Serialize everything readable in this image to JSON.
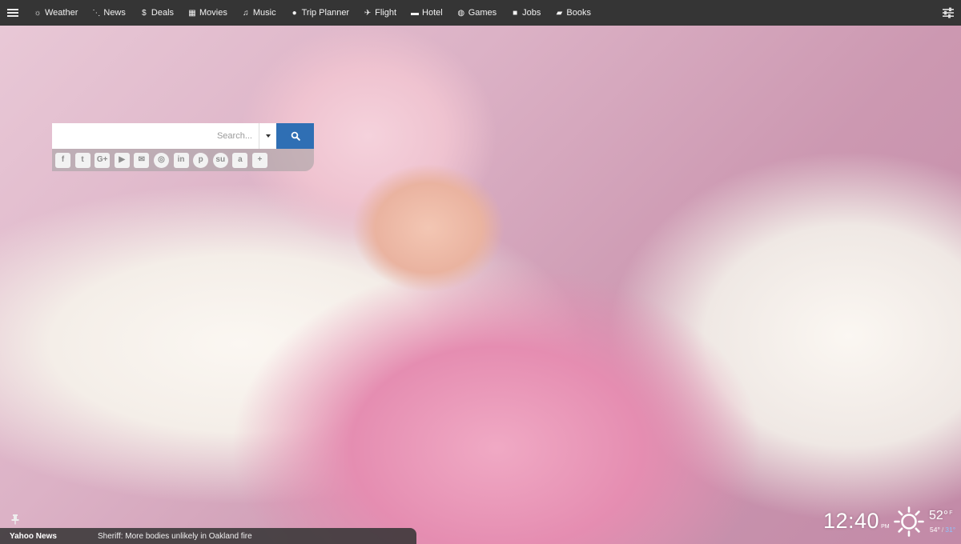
{
  "nav": {
    "items": [
      {
        "label": "Weather",
        "icon": "sun-icon",
        "glyph": "☼"
      },
      {
        "label": "News",
        "icon": "rss-icon",
        "glyph": "⋱"
      },
      {
        "label": "Deals",
        "icon": "dollar-icon",
        "glyph": "$"
      },
      {
        "label": "Movies",
        "icon": "film-icon",
        "glyph": "▦"
      },
      {
        "label": "Music",
        "icon": "music-icon",
        "glyph": "♫"
      },
      {
        "label": "Trip Planner",
        "icon": "globe-icon",
        "glyph": "●"
      },
      {
        "label": "Flight",
        "icon": "plane-icon",
        "glyph": "✈"
      },
      {
        "label": "Hotel",
        "icon": "bed-icon",
        "glyph": "▬"
      },
      {
        "label": "Games",
        "icon": "gamepad-icon",
        "glyph": "◍"
      },
      {
        "label": "Jobs",
        "icon": "briefcase-icon",
        "glyph": "■"
      },
      {
        "label": "Books",
        "icon": "book-icon",
        "glyph": "▰"
      }
    ]
  },
  "search": {
    "placeholder": "Search..."
  },
  "social": [
    {
      "name": "facebook-icon",
      "glyph": "f"
    },
    {
      "name": "twitter-icon",
      "glyph": "t"
    },
    {
      "name": "google-plus-icon",
      "glyph": "G+"
    },
    {
      "name": "youtube-icon",
      "glyph": "▶"
    },
    {
      "name": "email-icon",
      "glyph": "✉"
    },
    {
      "name": "instagram-icon",
      "glyph": "◎"
    },
    {
      "name": "linkedin-icon",
      "glyph": "in"
    },
    {
      "name": "pinterest-icon",
      "glyph": "p"
    },
    {
      "name": "stumbleupon-icon",
      "glyph": "su"
    },
    {
      "name": "amazon-icon",
      "glyph": "a"
    },
    {
      "name": "add-icon",
      "glyph": "+"
    }
  ],
  "ticker": {
    "source": "Yahoo News",
    "headline": "Sheriff: More bodies unlikely in Oakland fire"
  },
  "clock": {
    "time": "12:40",
    "ampm": "PM"
  },
  "weather": {
    "icon": "sun-icon",
    "temp": "52°",
    "unit_toggle": "F",
    "high": "54°",
    "low": "31°"
  },
  "colors": {
    "topbar": "#353535",
    "search_button": "#2f6fb4",
    "low_temp": "#8ec4ff"
  }
}
